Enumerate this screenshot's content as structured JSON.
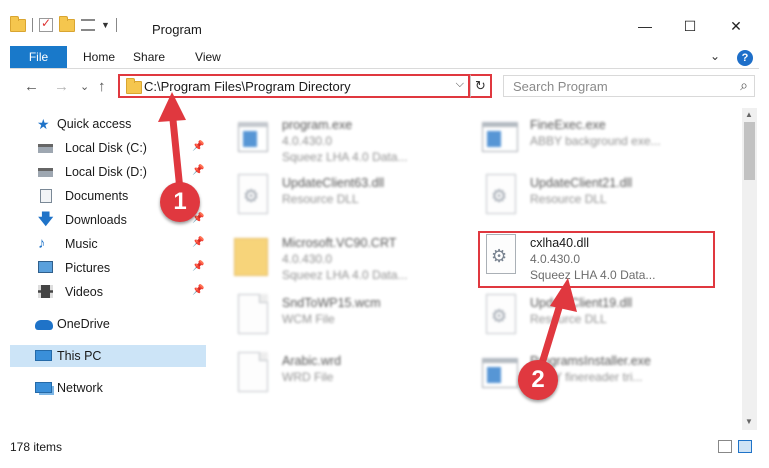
{
  "window": {
    "title": "Program",
    "minimize": "—",
    "maximize": "☐",
    "close": "✕"
  },
  "ribbon": {
    "tabs": [
      "File",
      "Home",
      "Share",
      "View"
    ],
    "help": "?"
  },
  "nav": {
    "back": "←",
    "forward": "→",
    "recent": "⌄",
    "up": "↑"
  },
  "address": {
    "path": "C:\\Program Files\\Program Directory",
    "dropdown": "⌵",
    "refresh": "↻"
  },
  "search": {
    "placeholder": "Search Program"
  },
  "sidebar": {
    "quick_access": "Quick access",
    "items": [
      {
        "label": "Local Disk (C:)",
        "icon": "disk-icon"
      },
      {
        "label": "Local Disk (D:)",
        "icon": "disk-icon"
      },
      {
        "label": "Documents",
        "icon": "documents-icon"
      },
      {
        "label": "Downloads",
        "icon": "downloads-icon"
      },
      {
        "label": "Music",
        "icon": "music-icon"
      },
      {
        "label": "Pictures",
        "icon": "pictures-icon"
      },
      {
        "label": "Videos",
        "icon": "videos-icon"
      }
    ],
    "onedrive": "OneDrive",
    "this_pc": "This PC",
    "network": "Network"
  },
  "files": [
    {
      "name": "program.exe",
      "line1": "4.0.430.0",
      "line2": "Squeez LHA 4.0 Data...",
      "type": "exe"
    },
    {
      "name": "FineExec.exe",
      "line1": "ABBY background exe...",
      "line2": "",
      "type": "exe"
    },
    {
      "name": "UpdateClient63.dll",
      "line1": "Resource DLL",
      "line2": "",
      "type": "dll"
    },
    {
      "name": "UpdateClient21.dll",
      "line1": "Resource DLL",
      "line2": "",
      "type": "dll"
    },
    {
      "name": "Microsoft.VC90.CRT",
      "line1": "4.0.430.0",
      "line2": "Squeez LHA 4.0 Data...",
      "type": "folder"
    },
    {
      "name": "cxlha40.dll",
      "line1": "4.0.430.0",
      "line2": "Squeez LHA 4.0 Data...",
      "type": "dll"
    },
    {
      "name": "SndToWP15.wcm",
      "line1": "WCM File",
      "line2": "",
      "type": "generic"
    },
    {
      "name": "UpdateClient19.dll",
      "line1": "Resource DLL",
      "line2": "",
      "type": "dll"
    },
    {
      "name": "Arabic.wrd",
      "line1": "WRD File",
      "line2": "",
      "type": "generic"
    },
    {
      "name": "ProgramsInstaller.exe",
      "line1": "ABBY finereader tri...",
      "line2": "",
      "type": "exe"
    }
  ],
  "status": {
    "count": "178 items"
  },
  "callouts": [
    "1",
    "2"
  ],
  "colors": {
    "accent": "#1979ca",
    "annotation": "#e0383f",
    "selected": "#cce4f7"
  }
}
